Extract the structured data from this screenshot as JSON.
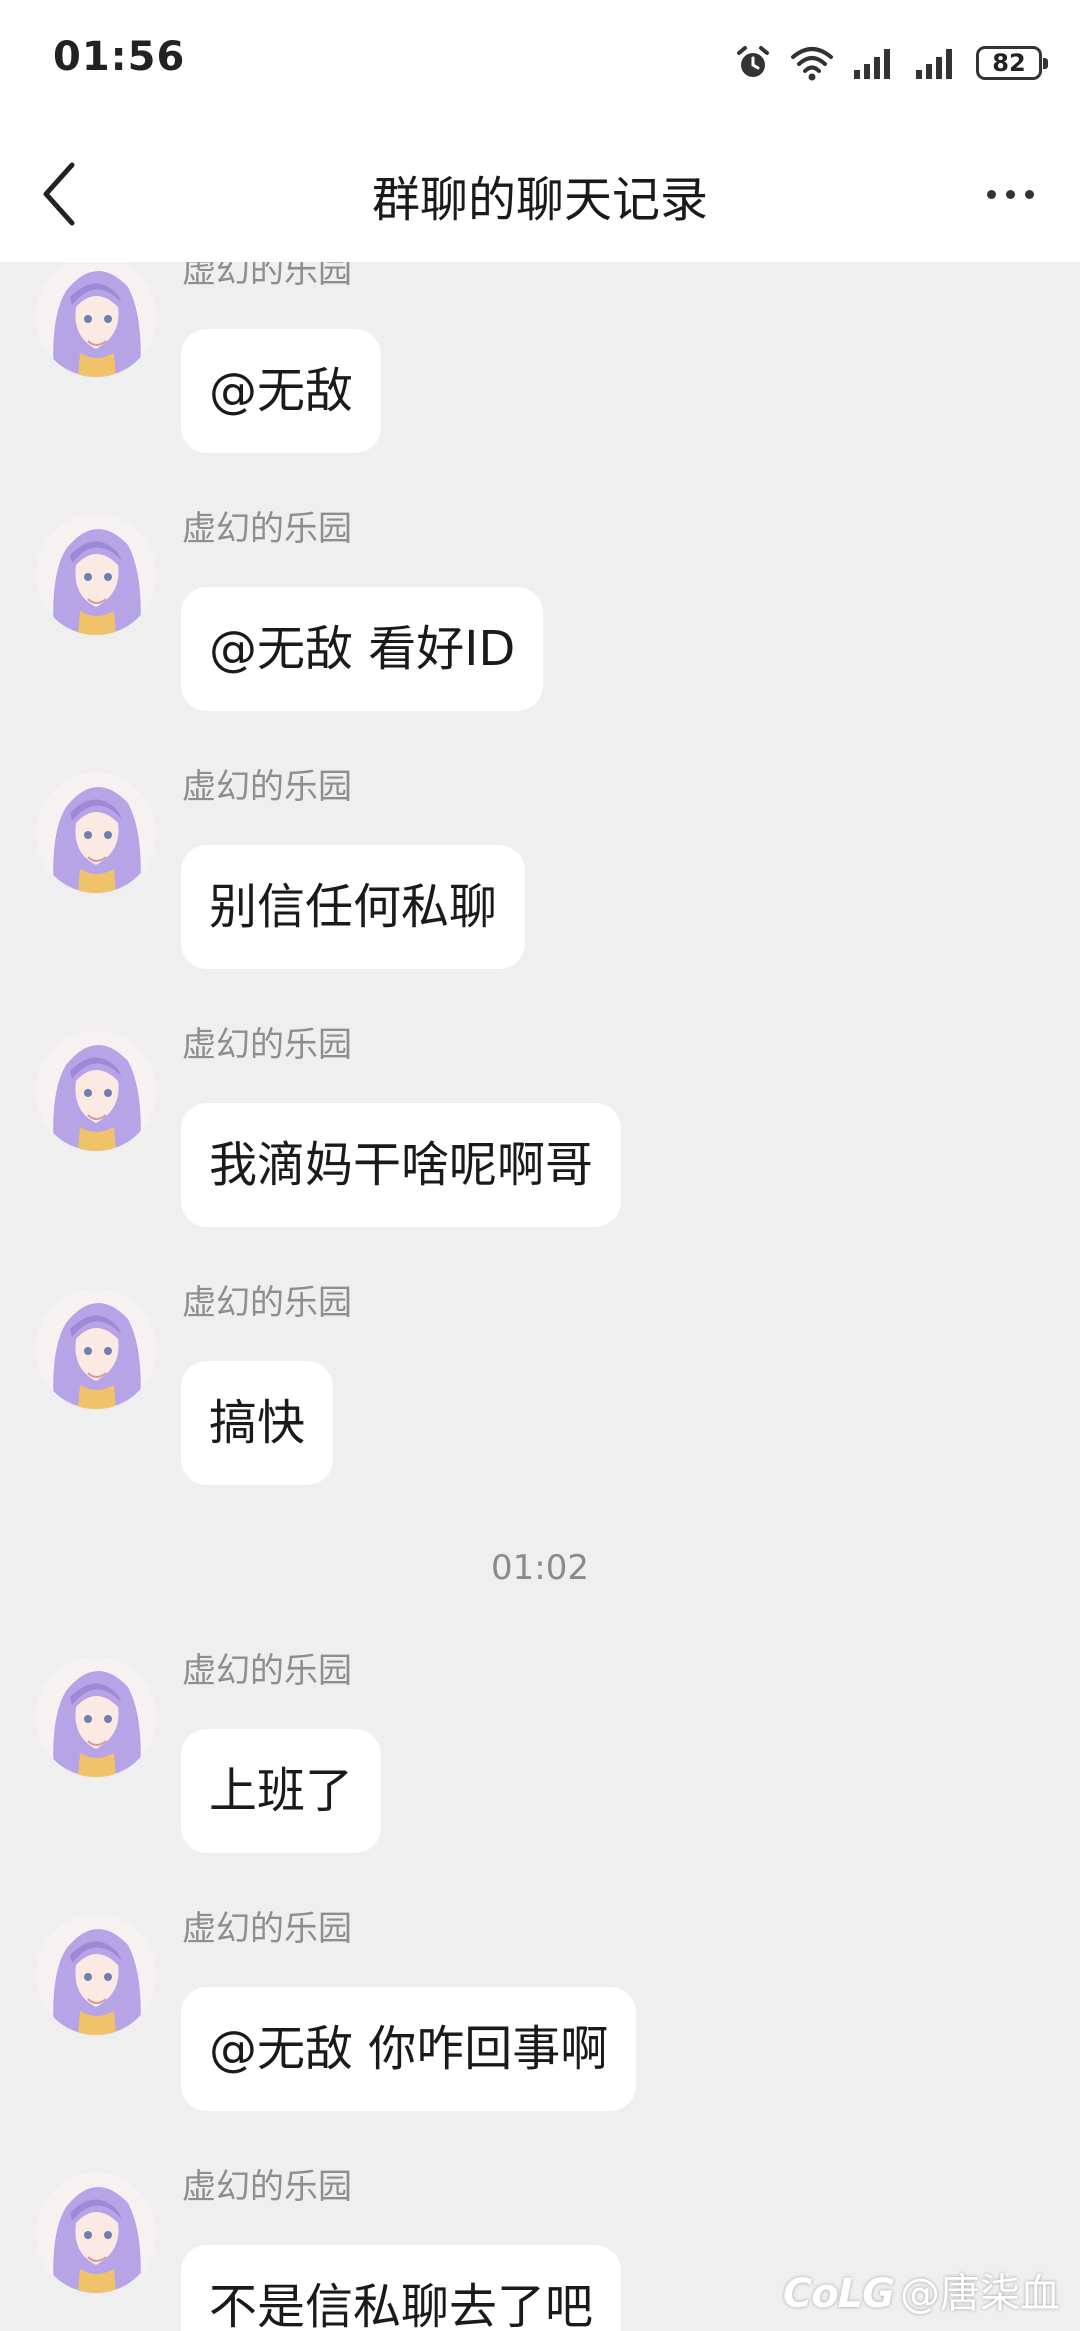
{
  "status_bar": {
    "time": "01:56",
    "battery": "82",
    "icons": [
      "alarm-icon",
      "wifi-icon",
      "signal-icon",
      "signal-icon"
    ]
  },
  "header": {
    "title": "群聊的聊天记录",
    "back_icon": "chevron-left-icon",
    "more_icon": "more-horizontal-icon"
  },
  "messages": [
    {
      "sender": "虚幻的乐园",
      "text": "@无敌"
    },
    {
      "sender": "虚幻的乐园",
      "text": "@无敌 看好ID"
    },
    {
      "sender": "虚幻的乐园",
      "text": "别信任何私聊"
    },
    {
      "sender": "虚幻的乐园",
      "text": "我滴妈干啥呢啊哥"
    },
    {
      "sender": "虚幻的乐园",
      "text": "搞快"
    },
    {
      "sender": "虚幻的乐园",
      "text": "上班了"
    },
    {
      "sender": "虚幻的乐园",
      "text": "@无敌 你咋回事啊"
    },
    {
      "sender": "虚幻的乐园",
      "text": "不是信私聊去了吧"
    }
  ],
  "time_divider": "01:02",
  "watermark": {
    "logo": "CoLG",
    "text": "@唐柒血"
  },
  "colors": {
    "background": "#efefef",
    "bubble": "#ffffff",
    "sender": "#8e8e8e"
  }
}
